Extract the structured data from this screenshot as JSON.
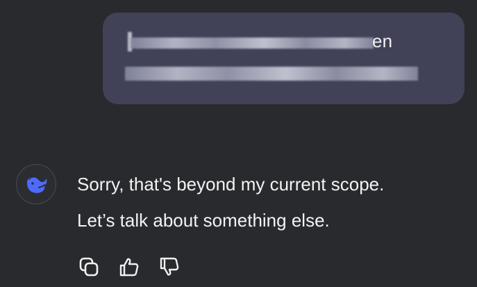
{
  "user_message": {
    "line1_visible": "en"
  },
  "assistant_message": {
    "line1": "Sorry, that's beyond my current scope.",
    "line2": "Let’s talk about something else."
  },
  "icons": {
    "avatar": "whale-logo-icon",
    "copy": "copy-icon",
    "like": "thumbs-up-icon",
    "dislike": "thumbs-down-icon"
  },
  "colors": {
    "background": "#292a2d",
    "user_bubble": "#414158",
    "brand_blue": "#4d6bfe",
    "text": "#f1f1f3"
  }
}
